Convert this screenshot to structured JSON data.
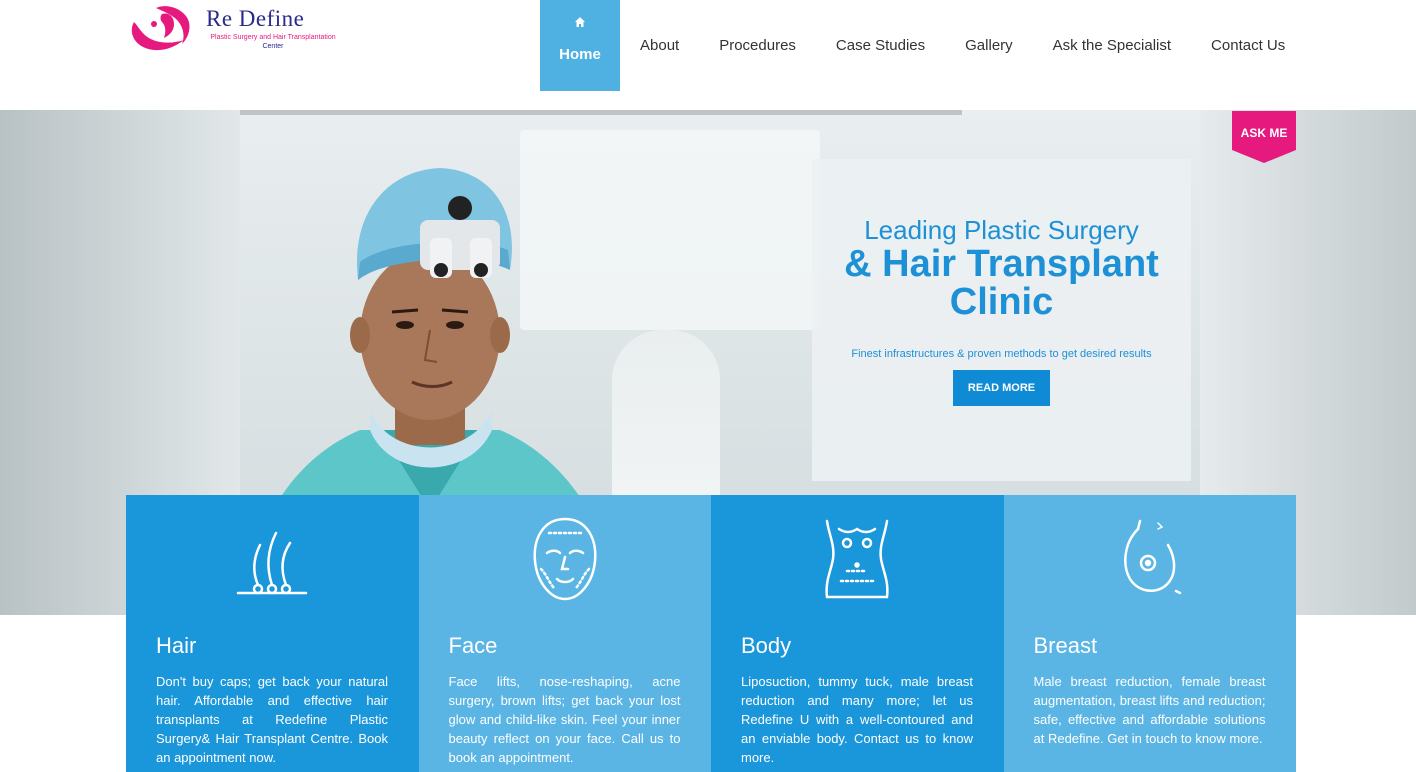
{
  "brand": {
    "name": "Re Define",
    "tagline": "Plastic Surgery and Hair Transplantation",
    "tagline2": "Center",
    "colors": {
      "pink": "#e6197e",
      "navy": "#2a2a8a",
      "blue": "#1a96da",
      "light_blue": "#5ab5e4"
    }
  },
  "nav": {
    "items": [
      {
        "label": "Home",
        "icon": "home-icon",
        "active": true
      },
      {
        "label": "About"
      },
      {
        "label": "Procedures"
      },
      {
        "label": "Case Studies"
      },
      {
        "label": "Gallery"
      },
      {
        "label": "Ask the Specialist"
      },
      {
        "label": "Contact Us"
      }
    ]
  },
  "ask_me": "ASK ME",
  "hero": {
    "line1": "Leading Plastic Surgery",
    "line2": "& Hair Transplant",
    "line3": "Clinic",
    "subtitle": "Finest infrastructures & proven methods to get desired results",
    "button": "READ MORE"
  },
  "services": [
    {
      "icon": "hair-follicle-icon",
      "title": "Hair",
      "description": "Don't buy caps; get back your natural hair. Affordable and effective hair transplants at Redefine Plastic Surgery& Hair Transplant Centre. Book an appointment now."
    },
    {
      "icon": "face-icon",
      "title": "Face",
      "description": "Face lifts, nose-reshaping, acne surgery, brown lifts; get back your lost glow and child-like skin. Feel your inner beauty reflect on your face. Call us to book an appointment."
    },
    {
      "icon": "body-torso-icon",
      "title": "Body",
      "description": "Liposuction, tummy tuck, male breast reduction and many more; let us Redefine U with a well-contoured and an enviable body. Contact us to know more."
    },
    {
      "icon": "breast-icon",
      "title": "Breast",
      "description": "Male breast reduction, female breast augmentation, breast lifts and reduction; safe, effective and affordable solutions at Redefine. Get in touch to know more."
    }
  ]
}
